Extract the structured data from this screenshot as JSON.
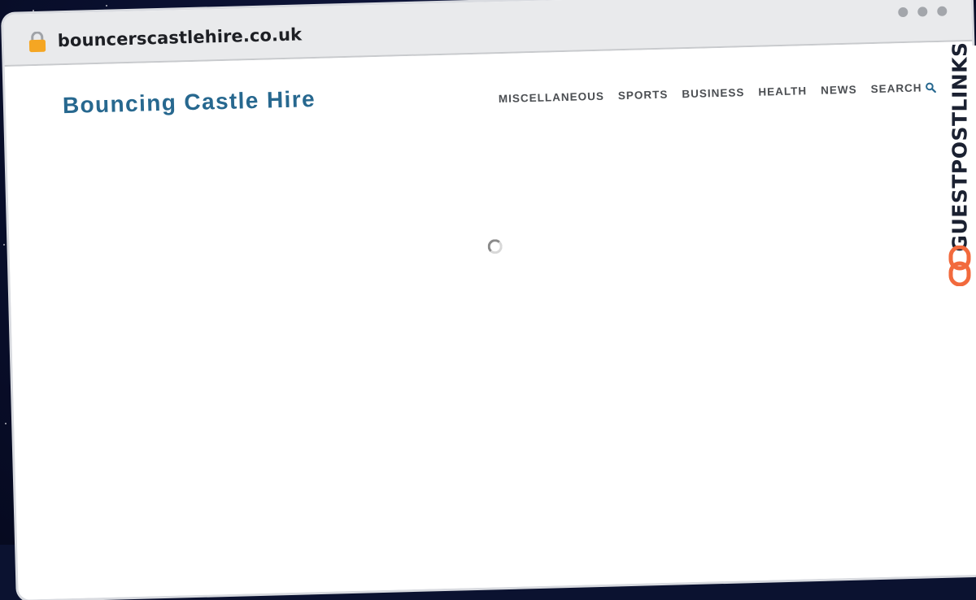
{
  "browser": {
    "url": "bouncerscastlehire.co.uk",
    "icons": {
      "lock": "lock-icon",
      "window_controls": [
        "window-dot-icon",
        "window-dot-icon",
        "window-dot-icon"
      ]
    }
  },
  "site": {
    "title": "Bouncing Castle Hire",
    "nav": [
      {
        "label": "MISCELLANEOUS"
      },
      {
        "label": "SPORTS"
      },
      {
        "label": "BUSINESS"
      },
      {
        "label": "HEALTH"
      },
      {
        "label": "NEWS"
      }
    ],
    "search_label": "SEARCH",
    "search_icon": "search-icon",
    "loading_icon": "loading-spinner-icon"
  },
  "brand": {
    "text": "GUESTPOSTLINKS",
    "icon": "chain-link-icon",
    "accent_color": "#f26a3d"
  },
  "colors": {
    "title": "#27688f",
    "nav": "#4b4e52",
    "background": "#0b1230"
  }
}
